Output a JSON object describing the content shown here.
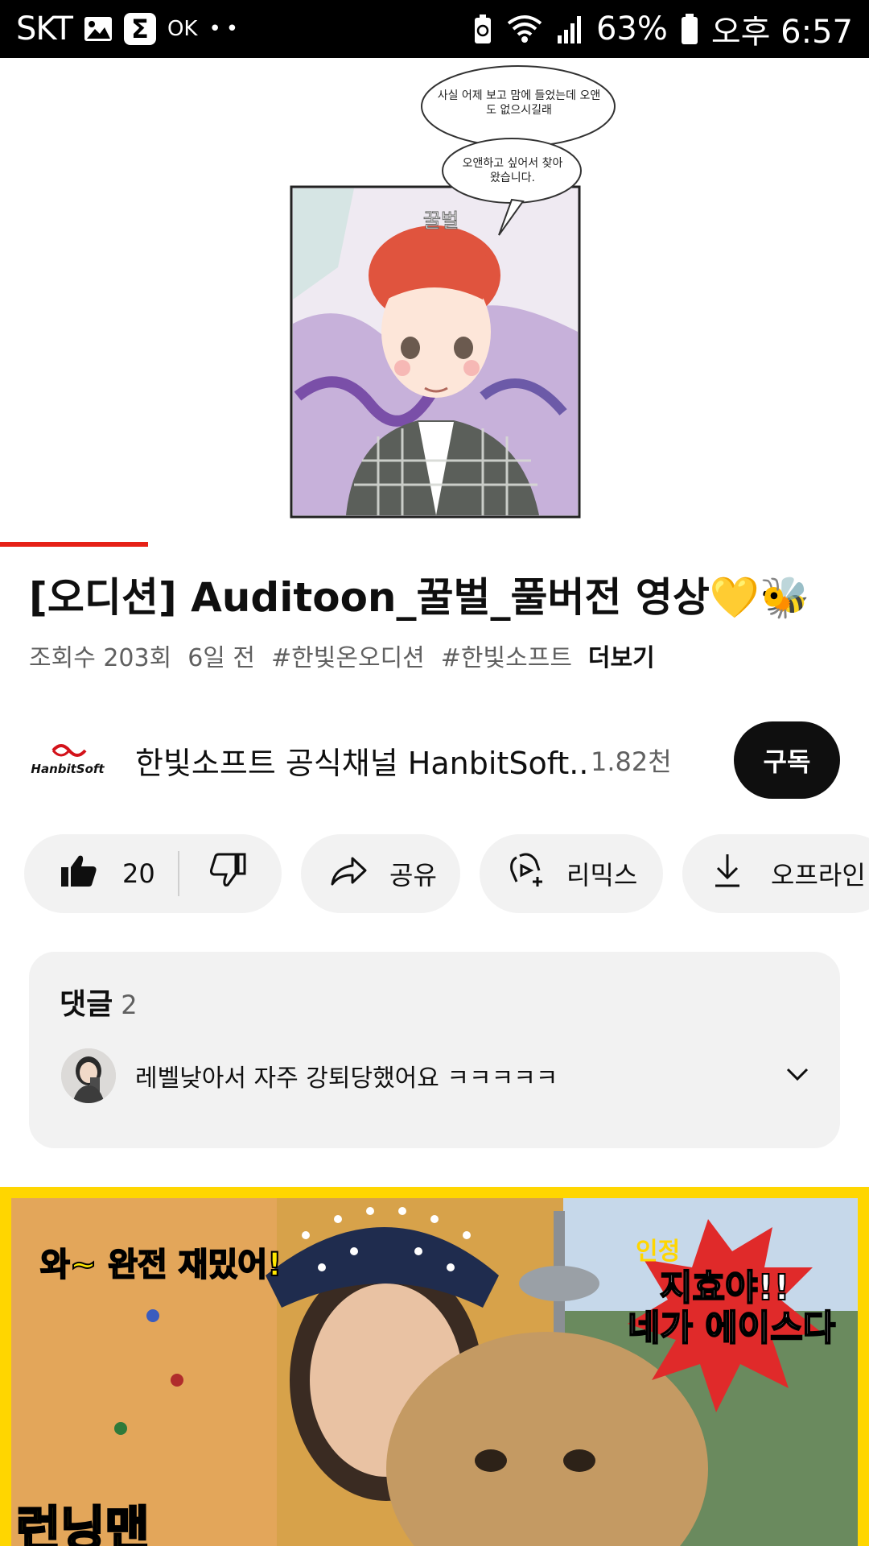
{
  "status_bar": {
    "carrier": "SKT",
    "battery": "63%",
    "time": "오후 6:57",
    "sigma": "Σ",
    "ok_label": "OK",
    "dots": "••"
  },
  "video": {
    "panel_speech_1": "사실 어제 보고 맘에 들었는데 오앤도 없으시길래",
    "panel_speech_2": "오앤하고 싶어서 찾아왔습니다.",
    "panel_name": "꿀벌",
    "progress": 0.17
  },
  "title": "[오디션] Auditoon_꿀벌_풀버전 영상💛🐝",
  "meta": {
    "views": "조회수 203회",
    "age": "6일 전",
    "tag1": "#한빛온오디션",
    "tag2": "#한빛소프트",
    "more": "더보기"
  },
  "channel": {
    "logo_text": "HanbitSoft",
    "name": "한빛소프트 공식채널 HanbitSoft...",
    "subscribers": "1.82천",
    "subscribe": "구독"
  },
  "actions": {
    "likes": "20",
    "share": "공유",
    "remix": "리믹스",
    "offline": "오프라인"
  },
  "comments": {
    "header": "댓글",
    "count": "2",
    "top_comment": "레벨낮아서 자주 강퇴당했어요 ㅋㅋㅋㅋㅋ"
  },
  "next_thumbnail": {
    "caption_left": "와~ 완전 재밌어!",
    "badge": "인정",
    "caption_right_1": "지효야!!",
    "caption_right_2": "네가 에이스다",
    "bottom_text": "런닝맨"
  },
  "colors": {
    "progress": "#e62117",
    "pill_bg": "#f2f2f2",
    "subscribe_bg": "#0f0f0f",
    "thumb_border": "#ffd600"
  }
}
